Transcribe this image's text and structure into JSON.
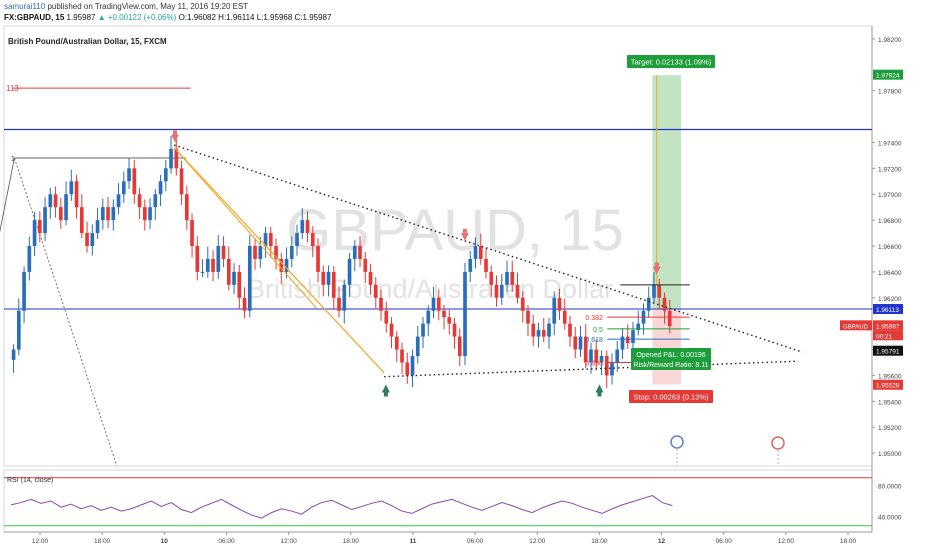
{
  "header": {
    "author": "samurai110",
    "published": "published on TradingView.com, May 11, 2016 19:20 EST",
    "ticker": "FX:GBPAUD, 15",
    "last": "1.95987",
    "change": "▲ +0.00122 (+0.06%)",
    "ohlc": "O:1.96082 H:1.96114 L:1.95968 C:1.95987",
    "symbol_title": "British Pound/Australian Dollar, 15, FXCM"
  },
  "watermark": {
    "main": "GBPAUD, 15",
    "sub": "British Pound/Australian Dollar"
  },
  "colors": {
    "up": "#2a6ebb",
    "down": "#e53935",
    "trend": "#f5a623",
    "level": "#2233cc",
    "target_zone": "#a8d8a8",
    "stop_zone": "#f7c6c6",
    "rsi": "#8e44ad",
    "green": "#1e9e3a"
  },
  "annotations": {
    "level_113": "113",
    "fib_382": "0.382",
    "fib_5": "0.5",
    "fib_618": "0.618",
    "fib_886": "0.886",
    "fib_1": "1",
    "target": "Target: 0.02133 (1.09%)",
    "stop": "Stop: 0.00263 (0.13%)",
    "pnl": "Opened P&L: 0.00196",
    "rr": "Risk/Reward Ratio: 8.11",
    "rsi_label": "RSI (14, close)"
  },
  "price_axis": {
    "ticks": [
      1.982,
      1.978,
      1.974,
      1.972,
      1.97,
      1.968,
      1.966,
      1.964,
      1.962,
      1.958,
      1.956,
      1.954,
      1.952,
      1.95
    ],
    "tick_labels": [
      "1.98200",
      "1.97800",
      "1.97400",
      "1.97200",
      "1.97000",
      "1.96800",
      "1.96600",
      "1.96400",
      "1.96200",
      "1.95800",
      "1.95600",
      "1.95400",
      "1.95200",
      "1.95000"
    ],
    "badges": [
      {
        "label": "1.97924",
        "value": 1.97924,
        "color": "#1e9e3a"
      },
      {
        "label": "1.96113",
        "value": 1.96113,
        "color": "#2233cc"
      },
      {
        "label": "1.95987",
        "value": 1.95987,
        "color": "#e53935"
      },
      {
        "label": "00:21",
        "value": 1.9591,
        "color": "#e53935"
      },
      {
        "label": "1.95791",
        "value": 1.95791,
        "color": "#111111"
      },
      {
        "label": "1.95528",
        "value": 1.95528,
        "color": "#e53935"
      }
    ],
    "symbol_badge": "GBPAUD"
  },
  "rsi_axis": {
    "tick_labels": [
      "80.0000",
      "40.0000"
    ],
    "ticks": [
      80,
      40
    ]
  },
  "time_axis": {
    "labels": [
      "12:00",
      "18:00",
      "10",
      "06:00",
      "12:00",
      "18:00",
      "11",
      "06:00",
      "12:00",
      "18:00",
      "12",
      "06:00",
      "12:00",
      "18:00"
    ]
  },
  "chart_data": {
    "type": "candlestick",
    "title": "British Pound/Australian Dollar, 15, FXCM",
    "ylim": [
      1.949,
      1.983
    ],
    "key_levels": {
      "level_113": 1.9782,
      "horizontal_resistance": 1.975,
      "horizontal_mid": 1.96113,
      "fib_1": 1.9728
    },
    "trendline_upper": [
      [
        0.18,
        1.9738
      ],
      [
        0.86,
        1.9588
      ]
    ],
    "trendline_lower": [
      [
        0.41,
        1.9559
      ],
      [
        0.86,
        1.9571
      ]
    ],
    "price_path": [
      1.958,
      1.961,
      1.964,
      1.966,
      1.968,
      1.967,
      1.969,
      1.97,
      1.969,
      1.968,
      1.97,
      1.971,
      1.969,
      1.967,
      1.966,
      1.967,
      1.968,
      1.969,
      1.968,
      1.969,
      1.97,
      1.971,
      1.972,
      1.97,
      1.969,
      1.968,
      1.969,
      1.97,
      1.971,
      1.972,
      1.9735,
      1.972,
      1.97,
      1.968,
      1.966,
      1.964,
      1.964,
      1.965,
      1.964,
      1.966,
      1.965,
      1.963,
      1.964,
      1.962,
      1.961,
      1.966,
      1.965,
      1.966,
      1.967,
      1.966,
      1.965,
      1.964,
      1.965,
      1.966,
      1.967,
      1.968,
      1.967,
      1.966,
      1.964,
      1.963,
      1.964,
      1.962,
      1.961,
      1.963,
      1.965,
      1.966,
      1.965,
      1.964,
      1.963,
      1.962,
      1.961,
      1.96,
      1.959,
      1.958,
      1.957,
      1.956,
      1.9575,
      1.959,
      1.96,
      1.961,
      1.962,
      1.961,
      1.9605,
      1.96,
      1.959,
      1.9575,
      1.964,
      1.965,
      1.966,
      1.965,
      1.964,
      1.963,
      1.962,
      1.963,
      1.964,
      1.963,
      1.962,
      1.961,
      1.96,
      1.959,
      1.9595,
      1.959,
      1.96,
      1.962,
      1.961,
      1.96,
      1.959,
      1.958,
      1.959,
      1.957,
      1.958,
      1.957,
      1.9575,
      1.956,
      1.957,
      1.958,
      1.959,
      1.9585,
      1.9595,
      1.96,
      1.961,
      1.962,
      1.963,
      1.962,
      1.961,
      1.9598
    ],
    "rsi": [
      55,
      58,
      62,
      57,
      60,
      52,
      56,
      50,
      54,
      48,
      52,
      47,
      50,
      55,
      60,
      53,
      58,
      49,
      45,
      52,
      57,
      62,
      55,
      48,
      42,
      38,
      45,
      50,
      47,
      43,
      52,
      58,
      61,
      55,
      49,
      53,
      57,
      60,
      54,
      47,
      44,
      50,
      56,
      59,
      62,
      57,
      52,
      48,
      53,
      58,
      54,
      49,
      45,
      51,
      56,
      60,
      57,
      52,
      48,
      44,
      50,
      55,
      59,
      63,
      67,
      58,
      54
    ]
  }
}
